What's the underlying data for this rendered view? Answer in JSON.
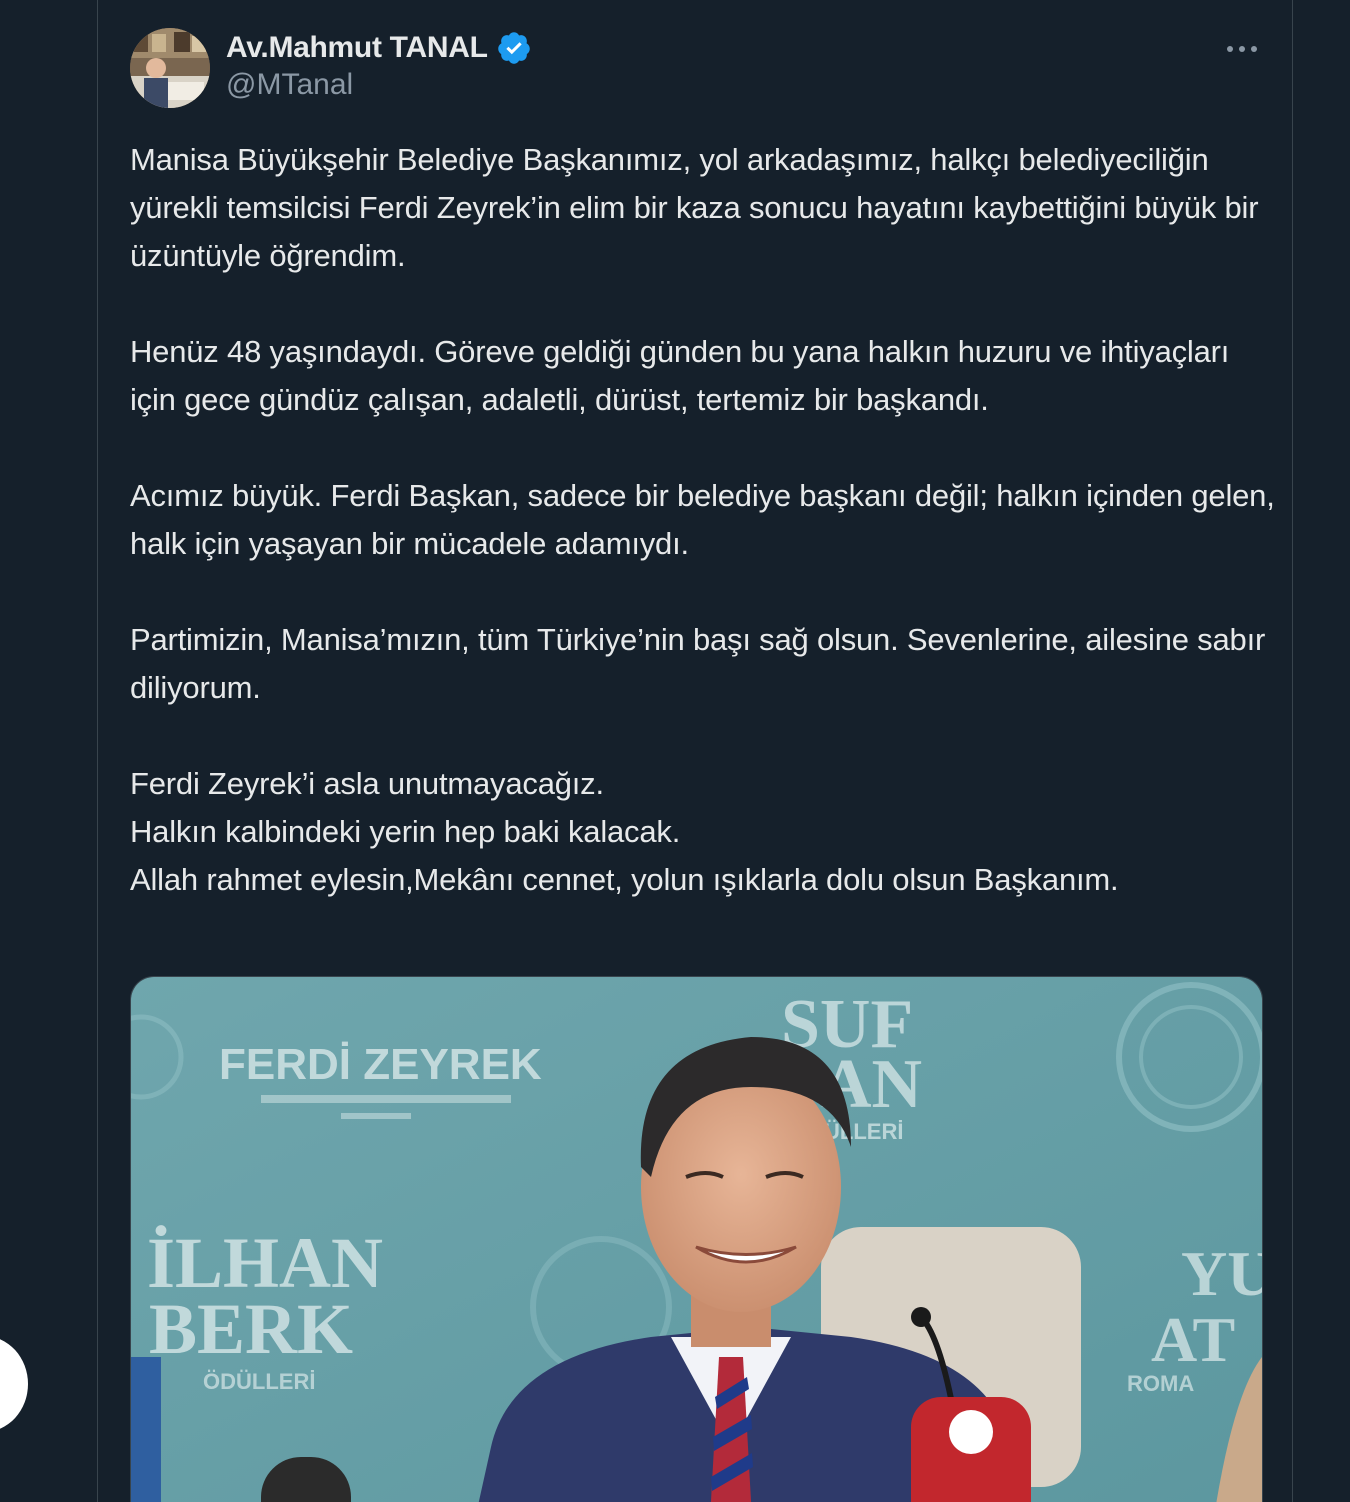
{
  "tweet": {
    "author": {
      "name": "Av.Mahmut TANAL",
      "handle": "@MTanal",
      "verified": true,
      "verified_color": "#1d9bf0",
      "avatar_icon": "profile-photo"
    },
    "more_icon": "more-horizontal-icon",
    "paragraphs": [
      "Manisa Büyükşehir Belediye Başkanımız, yol arkadaşımız, halkçı belediyeciliğin yürekli temsilcisi Ferdi Zeyrek’in elim bir kaza sonucu hayatını kaybettiğini büyük bir üzüntüyle öğrendim.",
      "Henüz 48 yaşındaydı. Göreve geldiği günden bu yana halkın huzuru ve ihtiyaçları için gece gündüz çalışan, adaletli, dürüst, tertemiz bir başkandı.",
      "Acımız büyük. Ferdi Başkan, sadece bir belediye başkanı değil; halkın içinden gelen, halk için yaşayan bir mücadele adamıydı.",
      "Partimizin, Manisa’mızın, tüm Türkiye’nin başı sağ olsun. Sevenlerine, ailesine sabır diliyorum.",
      "Ferdi Zeyrek’i asla unutmayacağız.\nHalkın kalbindeki yerin hep baki kalacak.\nAllah rahmet eylesin,Mekânı cennet, yolun ışıklarla dolu olsun Başkanım."
    ],
    "media": {
      "backdrop_text": {
        "left_title": "FERDİ ZEYREK",
        "center_top": "SUF",
        "center_mid": "AN",
        "center_sub": "ÖDÜLLERİ",
        "left_lower_1": "İLHAN",
        "left_lower_2": "BERK",
        "left_lower_3": "ÖDÜLLERİ",
        "right_1": "YU",
        "right_2": "AT",
        "right_3": "ROMA"
      }
    }
  },
  "colors": {
    "background": "#15202b",
    "border": "#38444d",
    "text_primary": "#e7e9ea",
    "text_secondary": "#8b98a5",
    "accent": "#1d9bf0"
  }
}
